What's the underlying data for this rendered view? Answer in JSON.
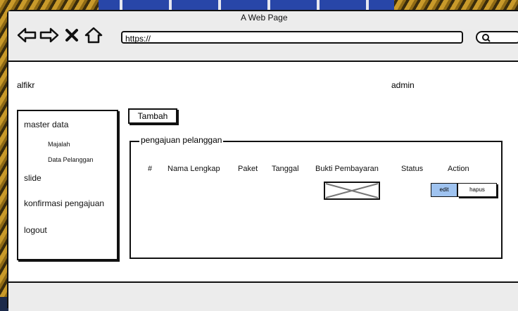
{
  "window": {
    "title": "A Web Page"
  },
  "browser": {
    "url": "https://",
    "nav_icons": [
      "back-icon",
      "forward-icon",
      "close-icon",
      "home-icon",
      "search-icon"
    ]
  },
  "header": {
    "site_name": "alfikr",
    "user_name": "admin"
  },
  "sidebar": {
    "items": [
      {
        "label": "master data"
      },
      {
        "label": "Majalah"
      },
      {
        "label": "Data Pelanggan"
      },
      {
        "label": "slide"
      },
      {
        "label": "konfirmasi pengajuan"
      },
      {
        "label": "logout"
      }
    ]
  },
  "main": {
    "add_button": "Tambah",
    "panel_title": "pengajuan pelanggan",
    "table": {
      "headers": [
        "#",
        "Nama Lengkap",
        "Paket",
        "Tanggal",
        "Bukti Pembayaran",
        "Status",
        "Action"
      ],
      "row": {
        "edit_label": "edit",
        "delete_label": "hapus"
      }
    }
  },
  "colors": {
    "edit_button": "#9fc3f0",
    "chrome": "#ececec",
    "outline": "#111111"
  }
}
